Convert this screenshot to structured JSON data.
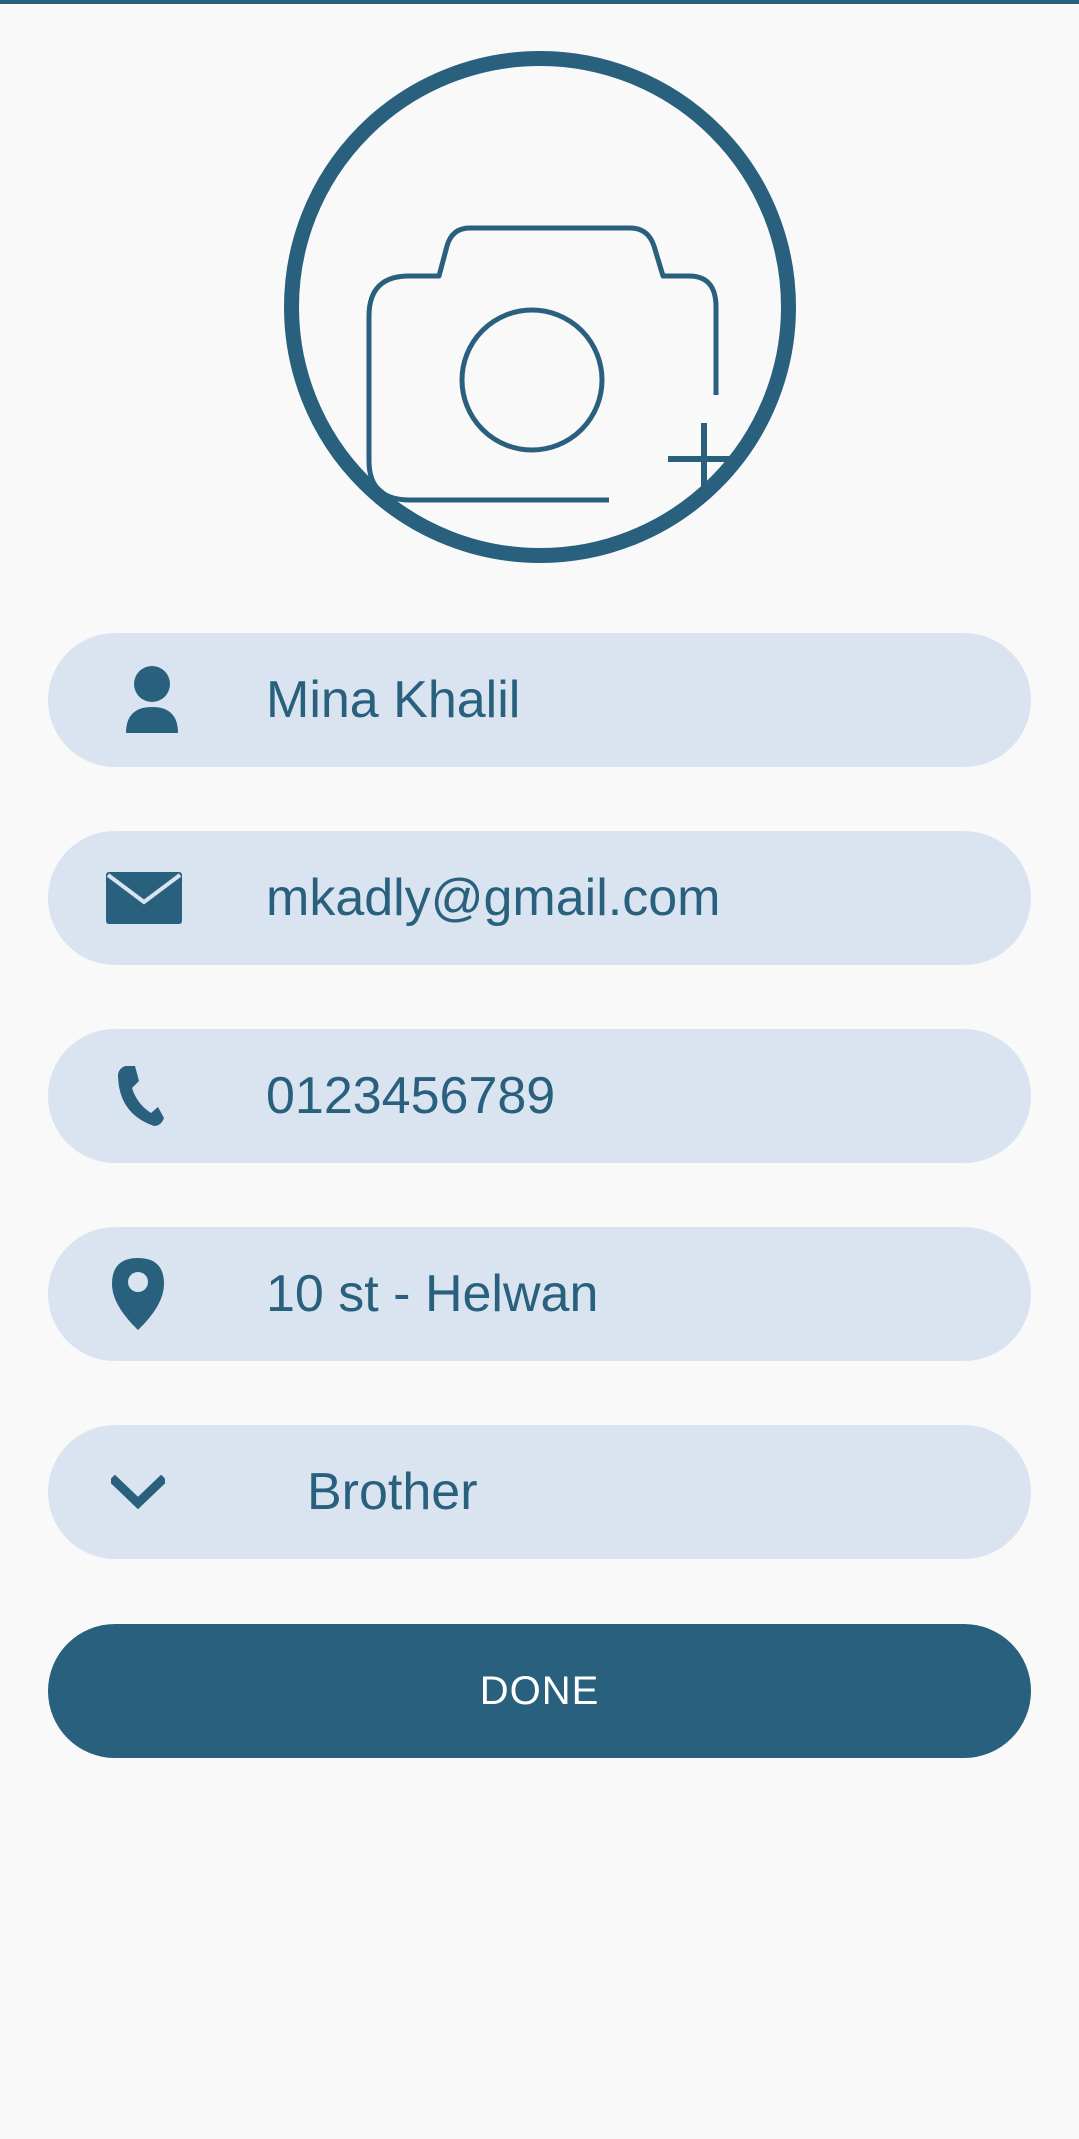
{
  "form": {
    "name": {
      "value": "Mina Khalil",
      "icon": "person-icon"
    },
    "email": {
      "value": "mkadly@gmail.com",
      "icon": "mail-icon"
    },
    "phone": {
      "value": "0123456789",
      "icon": "phone-icon"
    },
    "address": {
      "value": "10 st - Helwan",
      "icon": "location-pin-icon"
    },
    "relation": {
      "value": "Brother",
      "icon": "chevron-down-icon"
    }
  },
  "photo": {
    "icon": "add-photo-camera-icon"
  },
  "actions": {
    "done_label": "DONE"
  },
  "colors": {
    "primary": "#28607d",
    "field_background": "#d9e4f0",
    "page_background": "#f9f9f9"
  }
}
